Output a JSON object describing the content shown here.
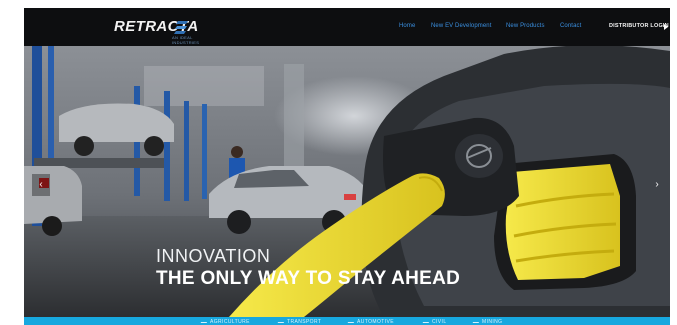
{
  "header": {
    "logo_text": "RETRACTA",
    "logo_subtext": "AN IDEAL INDUSTRIES",
    "nav": [
      "Home",
      "New EV Development",
      "New Products",
      "Contact"
    ],
    "login_label": "DISTRIBUTOR LOGIN"
  },
  "hero": {
    "headline_line1": "INNOVATION",
    "headline_line2": "THE ONLY WAY TO STAY AHEAD",
    "prev_icon": "chevron-left-icon",
    "next_icon": "chevron-right-icon"
  },
  "industries": [
    "AGRICULTURE",
    "TRANSPORT",
    "AUTOMOTIVE",
    "CIVIL",
    "MINING"
  ],
  "colors": {
    "header_bg": "#0d0e10",
    "nav_link": "#3a8fe0",
    "industry_bar": "#17a8df",
    "hose_yellow": "#f1e23a"
  }
}
